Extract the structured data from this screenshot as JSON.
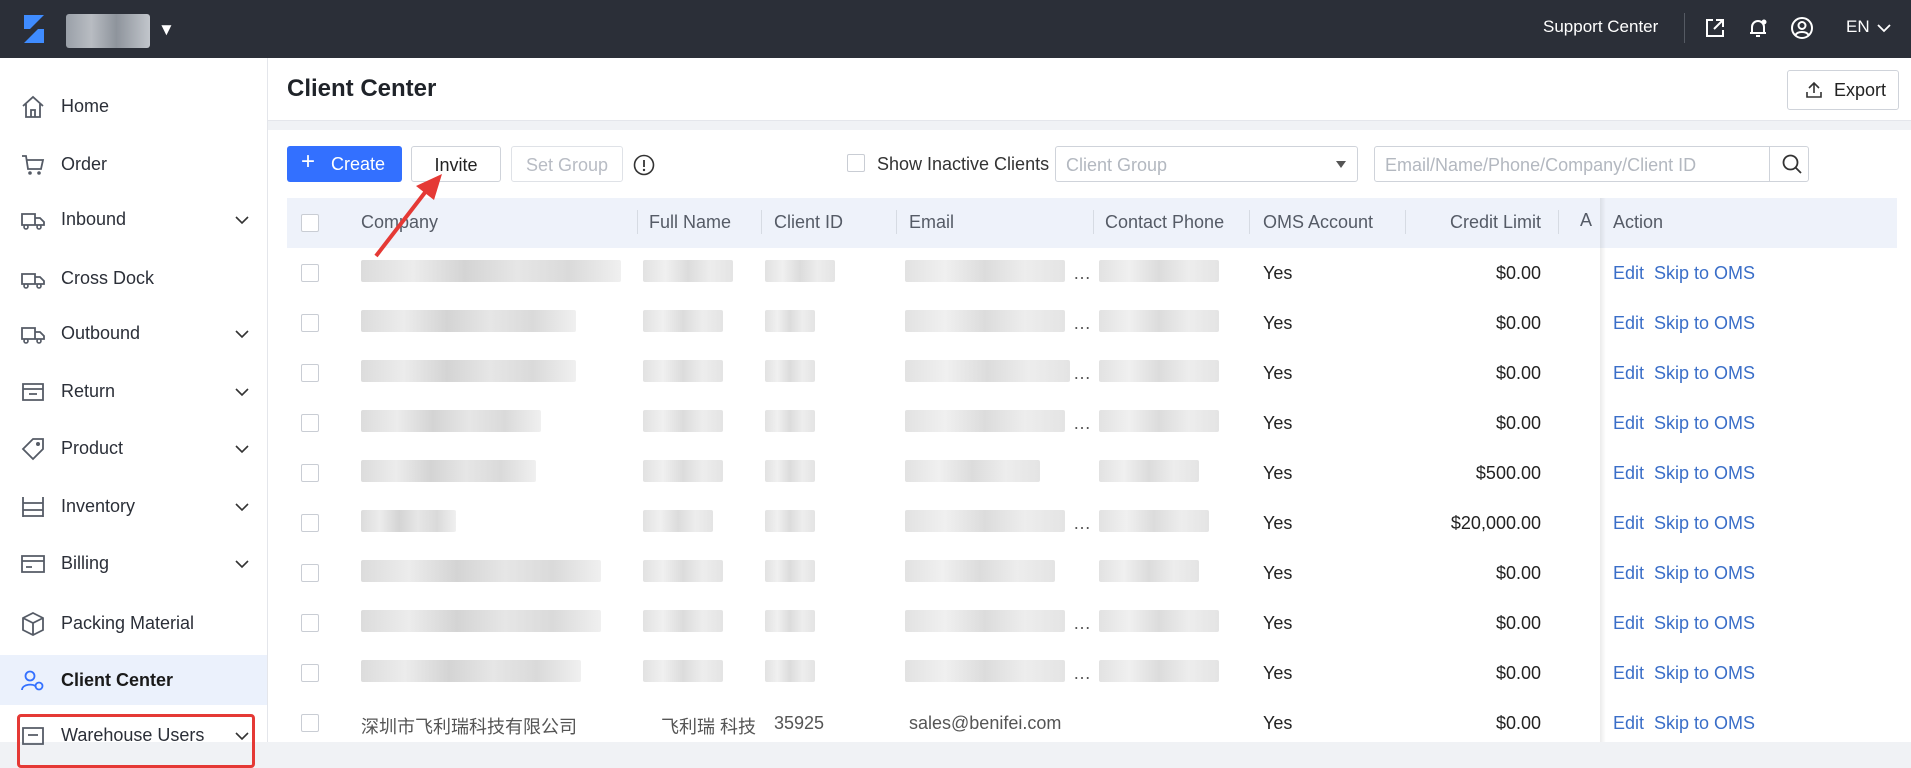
{
  "topbar": {
    "support_label": "Support Center",
    "lang_label": "EN",
    "icons": [
      "share-icon",
      "bell-icon",
      "user-circle-icon"
    ]
  },
  "sidebar": {
    "items": [
      {
        "label": "Home",
        "icon": "home-icon",
        "expandable": false
      },
      {
        "label": "Order",
        "icon": "cart-icon",
        "expandable": false
      },
      {
        "label": "Inbound",
        "icon": "inbound-truck-icon",
        "expandable": true
      },
      {
        "label": "Cross Dock",
        "icon": "cross-dock-truck-icon",
        "expandable": false
      },
      {
        "label": "Outbound",
        "icon": "outbound-truck-icon",
        "expandable": true
      },
      {
        "label": "Return",
        "icon": "return-box-icon",
        "expandable": true
      },
      {
        "label": "Product",
        "icon": "tag-icon",
        "expandable": true
      },
      {
        "label": "Inventory",
        "icon": "shelves-icon",
        "expandable": true
      },
      {
        "label": "Billing",
        "icon": "card-icon",
        "expandable": true
      },
      {
        "label": "Packing Material",
        "icon": "package-icon",
        "expandable": false
      },
      {
        "label": "Client Center",
        "icon": "client-gear-icon",
        "expandable": false,
        "active": true
      },
      {
        "label": "Warehouse Users",
        "icon": "warehouse-users-icon",
        "expandable": true
      }
    ]
  },
  "header": {
    "title": "Client Center",
    "export_label": "Export"
  },
  "toolbar": {
    "create_label": "Create",
    "invite_label": "Invite",
    "set_group_label": "Set Group",
    "show_inactive_label": "Show Inactive Clients",
    "client_group_placeholder": "Client Group",
    "search_placeholder": "Email/Name/Phone/Company/Client ID"
  },
  "table": {
    "columns": [
      "Company",
      "Full Name",
      "Client ID",
      "Email",
      "Contact Phone",
      "OMS Account",
      "Credit Limit",
      "A",
      "Action"
    ],
    "actions": {
      "edit": "Edit",
      "skip": "Skip to OMS"
    },
    "rows": [
      {
        "oms": "Yes",
        "credit": "$0.00",
        "company_text": "",
        "name_text": "",
        "id_text": "",
        "email_text": "",
        "email_ellipsis": true
      },
      {
        "oms": "Yes",
        "credit": "$0.00",
        "company_text": "",
        "name_text": "",
        "id_text": "",
        "email_text": "",
        "email_ellipsis": true
      },
      {
        "oms": "Yes",
        "credit": "$0.00",
        "company_text": "",
        "name_text": "",
        "id_text": "",
        "email_text": "",
        "email_ellipsis": true
      },
      {
        "oms": "Yes",
        "credit": "$0.00",
        "company_text": "",
        "name_text": "",
        "id_text": "",
        "email_text": "",
        "email_ellipsis": true
      },
      {
        "oms": "Yes",
        "credit": "$500.00",
        "company_text": "",
        "name_text": "",
        "id_text": "",
        "email_text": "",
        "email_ellipsis": false
      },
      {
        "oms": "Yes",
        "credit": "$20,000.00",
        "company_text": "",
        "name_text": "",
        "id_text": "",
        "email_text": "",
        "email_ellipsis": true
      },
      {
        "oms": "Yes",
        "credit": "$0.00",
        "company_text": "",
        "name_text": "",
        "id_text": "",
        "email_text": "",
        "email_ellipsis": false
      },
      {
        "oms": "Yes",
        "credit": "$0.00",
        "company_text": "",
        "name_text": "",
        "id_text": "",
        "email_text": "",
        "email_ellipsis": true
      },
      {
        "oms": "Yes",
        "credit": "$0.00",
        "company_text": "",
        "name_text": "",
        "id_text": "",
        "email_text": "",
        "email_ellipsis": true
      },
      {
        "oms": "Yes",
        "credit": "$0.00",
        "company_text": "深圳市飞利瑞科技有限公司",
        "name_text": "飞利瑞 科技",
        "id_text": "35925",
        "email_text": "sales@benifei.com",
        "email_ellipsis": false
      }
    ]
  },
  "colors": {
    "topbar_bg": "#2b2f38",
    "primary": "#3370ff",
    "link": "#3a6ec8",
    "highlight": "#e53935"
  }
}
